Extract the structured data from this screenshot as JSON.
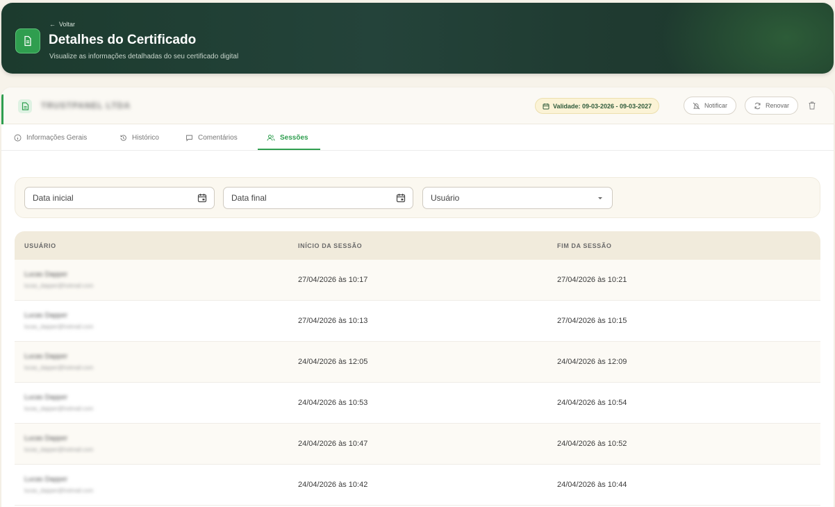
{
  "header": {
    "back_label": "Voltar",
    "title": "Detalhes do Certificado",
    "subtitle": "Visualize as informações detalhadas do seu certificado digital",
    "icon": "document-icon"
  },
  "certificate": {
    "name": "TRUSTPANEL LTDA",
    "validity": "Validade: 09-03-2026 - 09-03-2027",
    "notify_label": "Notificar",
    "renew_label": "Renovar"
  },
  "tabs": [
    {
      "label": "Informações Gerais",
      "icon": "info-icon",
      "active": false
    },
    {
      "label": "Histórico",
      "icon": "history-icon",
      "active": false
    },
    {
      "label": "Comentários",
      "icon": "comment-icon",
      "active": false
    },
    {
      "label": "Sessões",
      "icon": "users-icon",
      "active": true
    }
  ],
  "filters": {
    "start_placeholder": "Data inicial",
    "end_placeholder": "Data final",
    "user_placeholder": "Usuário"
  },
  "table": {
    "columns": [
      "USUÁRIO",
      "INÍCIO DA SESSÃO",
      "FIM DA SESSÃO"
    ],
    "rows": [
      {
        "user": "Lucas Dapper",
        "email": "lucas_dapper@hotmail.com",
        "start": "27/04/2026 às 10:17",
        "end": "27/04/2026 às 10:21"
      },
      {
        "user": "Lucas Dapper",
        "email": "lucas_dapper@hotmail.com",
        "start": "27/04/2026 às 10:13",
        "end": "27/04/2026 às 10:15"
      },
      {
        "user": "Lucas Dapper",
        "email": "lucas_dapper@hotmail.com",
        "start": "24/04/2026 às 12:05",
        "end": "24/04/2026 às 12:09"
      },
      {
        "user": "Lucas Dapper",
        "email": "lucas_dapper@hotmail.com",
        "start": "24/04/2026 às 10:53",
        "end": "24/04/2026 às 10:54"
      },
      {
        "user": "Lucas Dapper",
        "email": "lucas_dapper@hotmail.com",
        "start": "24/04/2026 às 10:47",
        "end": "24/04/2026 às 10:52"
      },
      {
        "user": "Lucas Dapper",
        "email": "lucas_dapper@hotmail.com",
        "start": "24/04/2026 às 10:42",
        "end": "24/04/2026 às 10:44"
      }
    ]
  },
  "colors": {
    "accent": "#2f9e4f",
    "header_bg": "#1c3b2e",
    "table_header_bg": "#f1ebdc"
  }
}
